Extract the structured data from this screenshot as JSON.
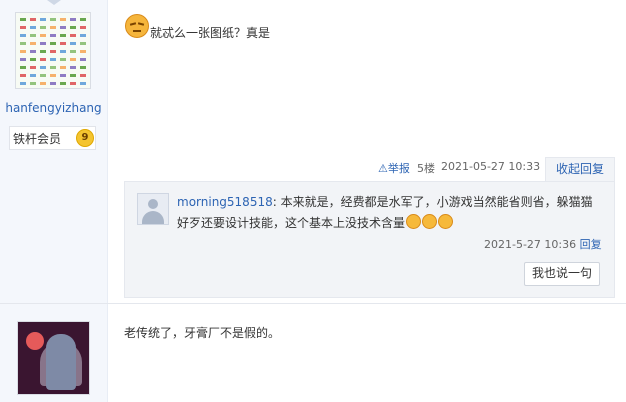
{
  "post1": {
    "user": {
      "username": "hanfengyizhang",
      "badge_label": "铁杆会员",
      "level": "9"
    },
    "content": "就忒么一张图纸？真是",
    "meta": {
      "report": "举报",
      "floor": "5楼",
      "time": "2021-05-27 10:33",
      "reply_toggle": "收起回复"
    },
    "reply": {
      "author": "morning518518",
      "text": ": 本来就是，经费都是水军了，小游戏当然能省则省，躲猫猫好歹还要设计技能，这个基本上没技术含量",
      "time": "2021-5-27 10:36",
      "reply_label": "回复"
    },
    "say_button": "我也说一句"
  },
  "post2": {
    "content": "老传统了，牙膏厂不是假的。"
  },
  "icons": [
    "pouting-face-icon",
    "warning-icon",
    "laugh-emoji-icon"
  ],
  "colors": {
    "link": "#2d64b3",
    "sidebar_bg": "#f4f7fc",
    "reply_bg": "#f2f4f7"
  }
}
